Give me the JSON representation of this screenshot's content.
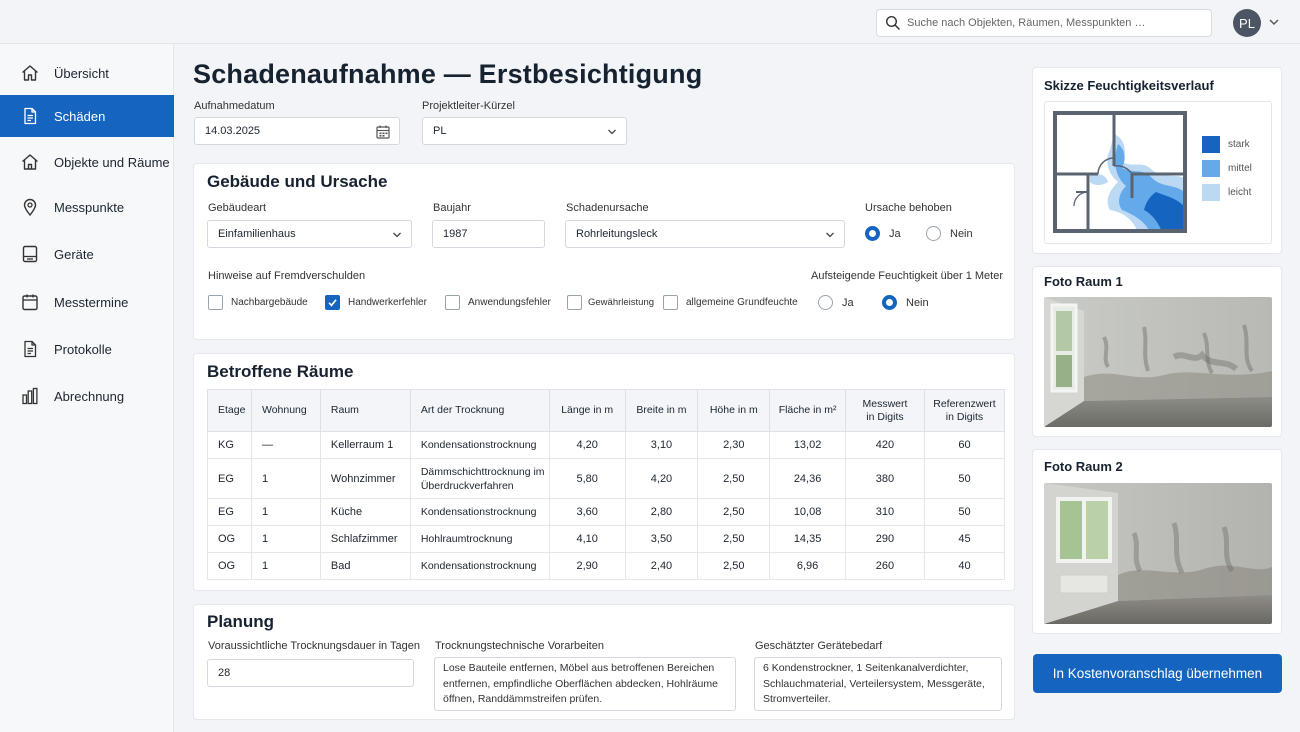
{
  "topbar": {
    "search_placeholder": "Suche nach Objekten, Räumen, Messpunkten …",
    "avatar_initials": "PL"
  },
  "sidebar": {
    "items": [
      {
        "label": "Übersicht",
        "icon": "home-icon"
      },
      {
        "label": "Schäden",
        "icon": "document-icon",
        "active": true
      },
      {
        "label": "Objekte und Räume",
        "icon": "building-icon"
      },
      {
        "label": "Messpunkte",
        "icon": "map-pin-icon"
      },
      {
        "label": "Geräte",
        "icon": "device-icon"
      },
      {
        "label": "Messtermine",
        "icon": "calendar-icon"
      },
      {
        "label": "Protokolle",
        "icon": "document-icon"
      },
      {
        "label": "Abrechnung",
        "icon": "bar-chart-icon"
      }
    ]
  },
  "page": {
    "title": "Schadenaufnahme — Erstbesichtigung",
    "date_label": "Aufnahmedatum",
    "date_value": "14.03.2025",
    "pl_label": "Projektleiter-Kürzel",
    "pl_value": "PL"
  },
  "building": {
    "title": "Gebäude und Ursache",
    "type_label": "Gebäudeart",
    "type_value": "Einfamilienhaus",
    "year_label": "Baujahr",
    "year_value": "1987",
    "cause_label": "Schadenursache",
    "cause_value": "Rohrleitungsleck",
    "fixed_label": "Ursache behoben",
    "fixed_yes": "Ja",
    "fixed_no": "Nein",
    "fixed_selected": "Ja",
    "hints_label": "Hinweise auf Fremdverschulden",
    "hints": [
      {
        "label": "Nachbargebäude",
        "checked": false
      },
      {
        "label": "Handwerkerfehler",
        "checked": true
      },
      {
        "label": "Anwendungsfehler",
        "checked": false
      },
      {
        "label": "Gewährleistung",
        "checked": false
      },
      {
        "label": "allgemeine Grundfeuchte",
        "checked": false
      }
    ],
    "rising_label": "Aufsteigende Feuchtigkeit über 1 Meter",
    "rising_yes": "Ja",
    "rising_no": "Nein",
    "rising_selected": "Nein"
  },
  "rooms": {
    "title": "Betroffene Räume",
    "headers": [
      "Etage",
      "Wohnung",
      "Raum",
      "Art der Trocknung",
      "Länge in m",
      "Breite in m",
      "Höhe in m",
      "Fläche in m²",
      "Messwert in Digits",
      "Referenzwert in Digits"
    ],
    "rows": [
      [
        "KG",
        "—",
        "Kellerraum 1",
        "Kondensationstrocknung",
        "4,20",
        "3,10",
        "2,30",
        "13,02",
        "420",
        "60"
      ],
      [
        "EG",
        "1",
        "Wohnzimmer",
        "Dämmschichttrocknung im Überdruckverfahren",
        "5,80",
        "4,20",
        "2,50",
        "24,36",
        "380",
        "50"
      ],
      [
        "EG",
        "1",
        "Küche",
        "Kondensationstrocknung",
        "3,60",
        "2,80",
        "2,50",
        "10,08",
        "310",
        "50"
      ],
      [
        "OG",
        "1",
        "Schlafzimmer",
        "Hohlraumtrocknung",
        "4,10",
        "3,50",
        "2,50",
        "14,35",
        "290",
        "45"
      ],
      [
        "OG",
        "1",
        "Bad",
        "Kondensationstrocknung",
        "2,90",
        "2,40",
        "2,50",
        "6,96",
        "260",
        "40"
      ]
    ]
  },
  "planning": {
    "title": "Planung",
    "duration_label": "Voraussichtliche Trocknungsdauer in Tagen",
    "duration_value": "28",
    "prep_label": "Trocknungstechnische Vorarbeiten",
    "prep_value": "Lose Bauteile entfernen, Möbel aus betroffenen Bereichen entfernen, empfindliche Oberflächen abdecken, Hohlräume öffnen, Randdämmstreifen prüfen.",
    "equipment_label": "Geschätzter Gerätebedarf",
    "equipment_value": "6 Kondenstrockner, 1 Seitenkanalverdichter, Schlauchmaterial, Verteilersystem, Messgeräte, Stromverteiler."
  },
  "sketch": {
    "title": "Skizze Feuchtigkeitsverlauf",
    "legend": [
      {
        "label": "stark",
        "color": "#1565c0"
      },
      {
        "label": "mittel",
        "color": "#64aaeb"
      },
      {
        "label": "leicht",
        "color": "#bcd9f3"
      }
    ]
  },
  "photos": {
    "photo1_title": "Foto Raum 1",
    "photo2_title": "Foto Raum 2"
  },
  "cta": {
    "label": "In Kostenvoranschlag übernehmen"
  }
}
